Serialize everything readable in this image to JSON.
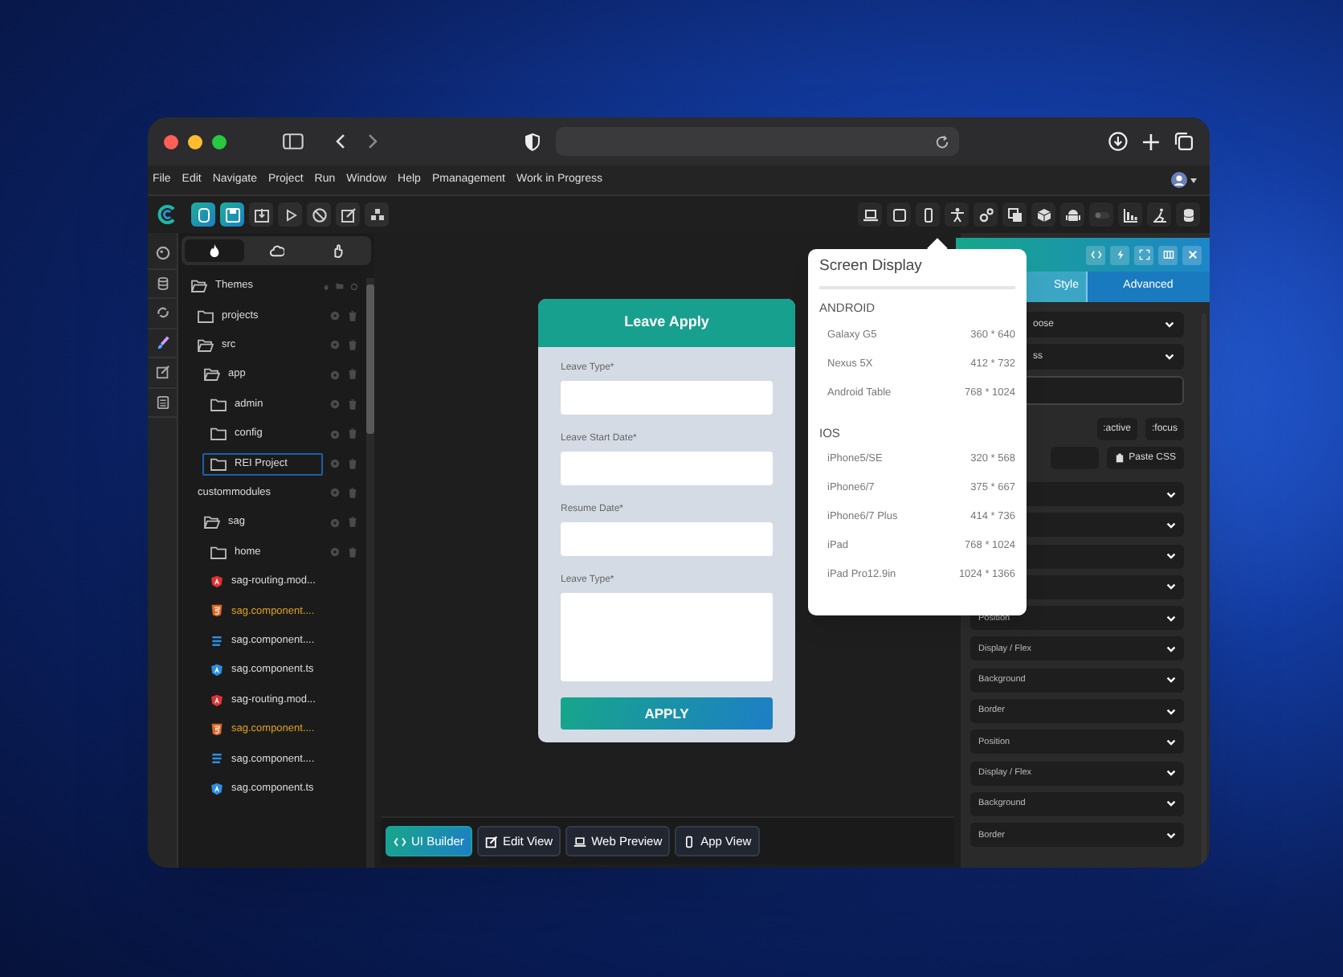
{
  "menu": [
    "File",
    "Edit",
    "Navigate",
    "Project",
    "Run",
    "Window",
    "Help",
    "Pmanagement",
    "Work in Progress"
  ],
  "toolbar": {
    "left_buttons": [
      {
        "on": true
      },
      {
        "on": true
      },
      {
        "on": false
      },
      {
        "on": false
      },
      {
        "on": false
      },
      {
        "on": false
      },
      {
        "on": false
      }
    ]
  },
  "sidebar_tabs": [
    {
      "selected": true
    },
    {
      "selected": false
    },
    {
      "selected": false
    }
  ],
  "tree": [
    {
      "label": "Themes",
      "kind": "root",
      "expanded": true,
      "selected": false,
      "children": [
        {
          "label": "projects",
          "kind": "folder",
          "expanded": false,
          "selected": false
        },
        {
          "label": "src",
          "kind": "folder",
          "expanded": true,
          "selected": false,
          "children": [
            {
              "label": "app",
              "kind": "folder",
              "expanded": true,
              "selected": false,
              "children": [
                {
                  "label": "admin",
                  "kind": "folder",
                  "expanded": false,
                  "selected": false
                },
                {
                  "label": "config",
                  "kind": "folder",
                  "expanded": false,
                  "selected": false
                },
                {
                  "label": "REI Project",
                  "kind": "folder",
                  "expanded": false,
                  "selected": true
                }
              ]
            },
            {
              "label": "custommodules",
              "kind": "module",
              "expanded": false,
              "selected": false
            },
            {
              "label": "sag",
              "kind": "folder",
              "expanded": true,
              "selected": false,
              "children": [
                {
                  "label": "home",
                  "kind": "folder",
                  "expanded": false,
                  "selected": false
                },
                {
                  "label": "sag-routing.mod...",
                  "kind": "angular",
                  "selected": false
                },
                {
                  "label": "sag.component....",
                  "kind": "html",
                  "selected": false
                },
                {
                  "label": "sag.component....",
                  "kind": "css",
                  "selected": false
                },
                {
                  "label": "sag.component.ts",
                  "kind": "ts",
                  "selected": false
                },
                {
                  "label": "sag-routing.mod...",
                  "kind": "angular",
                  "selected": false
                },
                {
                  "label": "sag.component....",
                  "kind": "html",
                  "selected": false
                },
                {
                  "label": "sag.component....",
                  "kind": "css",
                  "selected": false
                },
                {
                  "label": "sag.component.ts",
                  "kind": "ts",
                  "selected": false
                }
              ]
            }
          ]
        }
      ]
    }
  ],
  "form": {
    "title": "Leave Apply",
    "fields": [
      {
        "label": "Leave Type*",
        "kind": "input"
      },
      {
        "label": "Leave Start Date*",
        "kind": "input"
      },
      {
        "label": "Resume Date*",
        "kind": "input"
      },
      {
        "label": "Leave Type*",
        "kind": "textarea"
      }
    ],
    "button": "APPLY"
  },
  "view_buttons": [
    {
      "label": "UI Builder",
      "selected": true
    },
    {
      "label": "Edit View",
      "selected": false
    },
    {
      "label": "Web Preview",
      "selected": false
    },
    {
      "label": "App View",
      "selected": false
    }
  ],
  "screen_display": {
    "title": "Screen Display",
    "sections": [
      {
        "name": "ANDROID",
        "devices": [
          {
            "name": "Galaxy G5",
            "size": "360 * 640"
          },
          {
            "name": "Nexus 5X",
            "size": "412 * 732"
          },
          {
            "name": "Android Table",
            "size": "768 * 1024"
          }
        ]
      },
      {
        "name": "IOS",
        "devices": [
          {
            "name": "iPhone5/SE",
            "size": "320 * 568"
          },
          {
            "name": "iPhone6/7",
            "size": "375 * 667"
          },
          {
            "name": "iPhone6/7 Plus",
            "size": "414 * 736"
          },
          {
            "name": "iPad",
            "size": "768 * 1024"
          },
          {
            "name": "iPad Pro12.9in",
            "size": "1024 * 1366"
          }
        ]
      }
    ]
  },
  "properties": {
    "tabs": [
      {
        "label": "Style",
        "selected": true
      },
      {
        "label": "Advanced",
        "selected": false
      }
    ],
    "selects": [
      "oose",
      "ss"
    ],
    "states": [
      ":active",
      ":focus"
    ],
    "paste": "Paste CSS",
    "sections": [
      {
        "kind": "covered"
      },
      {
        "kind": "covered"
      },
      {
        "kind": "covered"
      },
      {
        "kind": "covered"
      },
      {
        "kind": "labeled",
        "label": "Position"
      },
      {
        "kind": "labeled",
        "label": "Display / Flex"
      },
      {
        "kind": "labeled",
        "label": "Background"
      },
      {
        "kind": "labeled",
        "label": "Border"
      },
      {
        "kind": "labeled",
        "label": "Position"
      },
      {
        "kind": "labeled",
        "label": "Display / Flex"
      },
      {
        "kind": "labeled",
        "label": "Background"
      },
      {
        "kind": "labeled",
        "label": "Border"
      }
    ]
  }
}
